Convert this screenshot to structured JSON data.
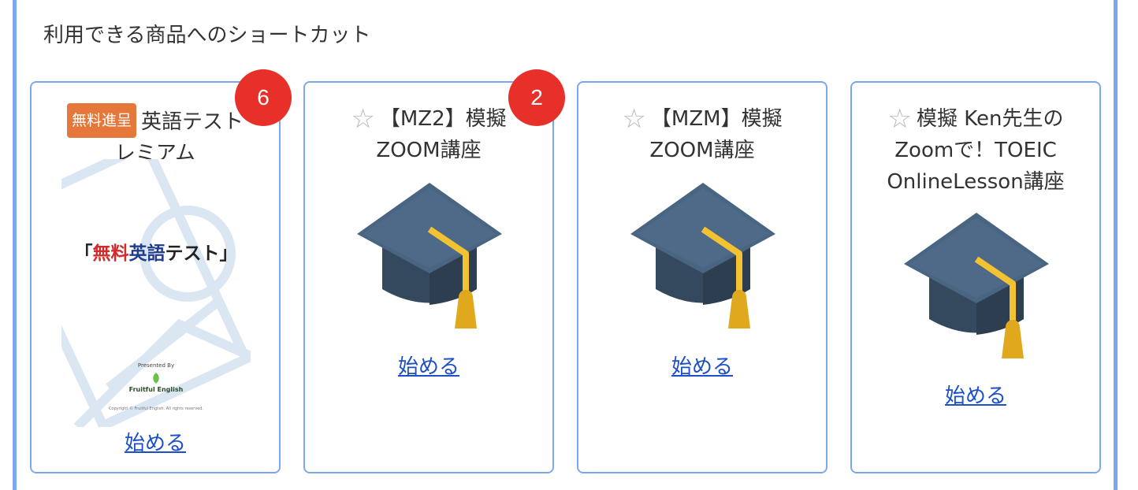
{
  "section": {
    "title": "利用できる商品へのショートカット"
  },
  "cards": [
    {
      "badge_count": "6",
      "tag": "無料進呈",
      "title_line1": "英語テスト",
      "title_line2": "レミアム",
      "thumb": {
        "title_bracket_open": "「",
        "title_part1": "無料",
        "title_part2": "英語",
        "title_part3": "テスト",
        "title_bracket_close": "」",
        "presented_by": "Presented By",
        "brand": "Fruitful English",
        "copyright": "Copyright © Fruitful English. All rights reserved."
      },
      "start_label": "始める",
      "icon": "document-thumbnail"
    },
    {
      "badge_count": "2",
      "title_line1": "【MZ2】模擬",
      "title_line2": "ZOOM講座",
      "start_label": "始める",
      "icon": "graduation-cap-icon"
    },
    {
      "title_line1": "【MZM】模擬",
      "title_line2": "ZOOM講座",
      "start_label": "始める",
      "icon": "graduation-cap-icon"
    },
    {
      "title_line1": "模擬 Ken先生の",
      "title_line2": "Zoomで！TOEIC",
      "title_line3": "OnlineLesson講座",
      "start_label": "始める",
      "icon": "graduation-cap-icon"
    }
  ],
  "colors": {
    "border": "#7ea6f0",
    "badge": "#e8302a",
    "tag": "#e5773a",
    "link": "#1d4fc6",
    "cap_top": "#4a6582",
    "tassel": "#f2c230"
  }
}
